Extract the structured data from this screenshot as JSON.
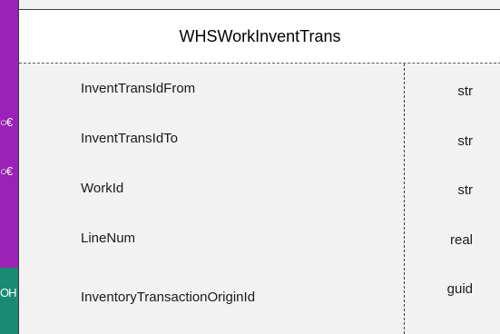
{
  "entity": {
    "title": "WHSWorkInventTrans",
    "fields": [
      {
        "name": "InventTransIdFrom",
        "type": "str"
      },
      {
        "name": "InventTransIdTo",
        "type": "str"
      },
      {
        "name": "WorkId",
        "type": "str"
      },
      {
        "name": "LineNum",
        "type": "real"
      },
      {
        "name": "InventoryTransactionOriginId",
        "type": "guid"
      }
    ]
  },
  "colors": {
    "background_purple": "#9b22b6",
    "background_teal": "#1a8a73",
    "entity_fill": "#f2f2f2",
    "header_fill": "#ffffff"
  },
  "connectors": {
    "crowfoot_1": "○€",
    "crowfoot_2": "○€",
    "crowfoot_3": "OH"
  }
}
